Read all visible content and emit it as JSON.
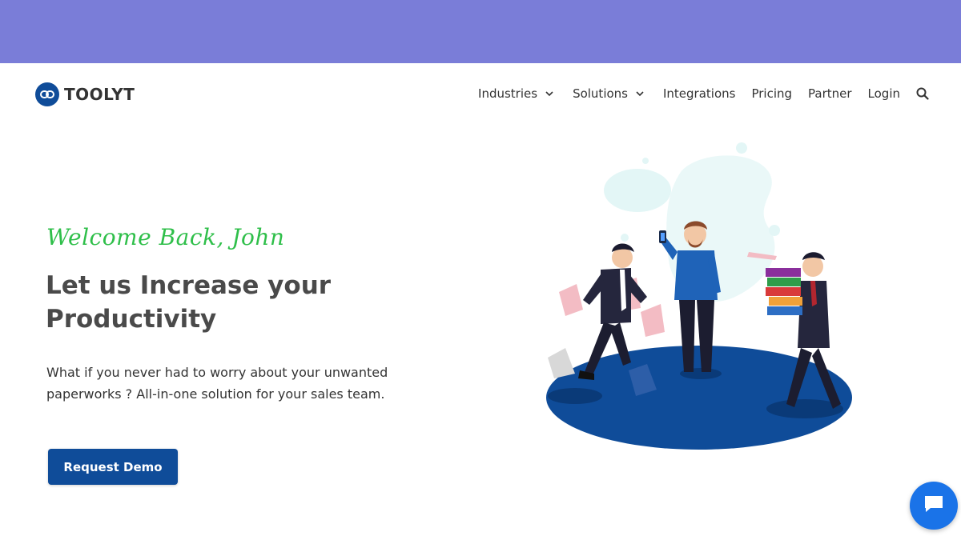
{
  "colors": {
    "top_band": "#7a7dd8",
    "brand_blue": "#0f4c99",
    "welcome_green": "#2fbf4a",
    "chat_blue": "#1a73e8"
  },
  "brand": {
    "name": "TOOLYT",
    "logo_icon": "chain-link-icon"
  },
  "nav": {
    "items": [
      {
        "label": "Industries",
        "has_dropdown": true
      },
      {
        "label": "Solutions",
        "has_dropdown": true
      },
      {
        "label": "Integrations",
        "has_dropdown": false
      },
      {
        "label": "Pricing",
        "has_dropdown": false
      },
      {
        "label": "Partner",
        "has_dropdown": false
      },
      {
        "label": "Login",
        "has_dropdown": false
      }
    ],
    "search_icon": "search-icon"
  },
  "hero": {
    "welcome": "Welcome Back, John",
    "headline_line1": "Let us Increase your",
    "headline_line2": "Productivity",
    "description": "What if you never had to worry about your unwanted paperworks ? All-in-one solution for your sales team.",
    "cta_label": "Request Demo",
    "illustration_icon": "business-team-illustration"
  },
  "chat": {
    "icon": "chat-bubble-icon"
  }
}
